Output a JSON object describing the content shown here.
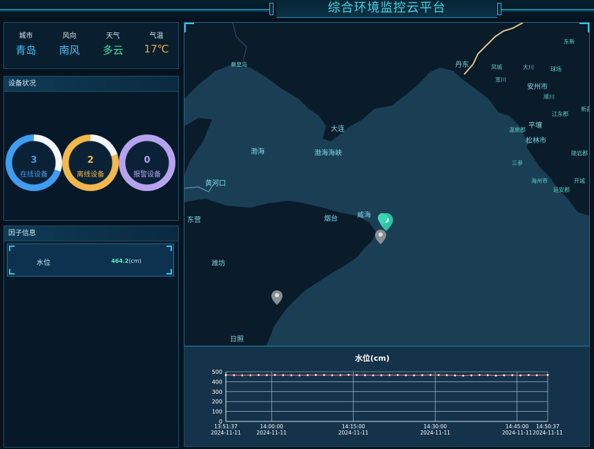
{
  "header": {
    "title": "综合环境监控云平台"
  },
  "weather": [
    {
      "label": "城市",
      "value": "青岛",
      "color": "#3fc6ff"
    },
    {
      "label": "风向",
      "value": "南风",
      "color": "#3fc6ff"
    },
    {
      "label": "天气",
      "value": "多云",
      "color": "#37e6a7"
    },
    {
      "label": "气温",
      "value": "17℃",
      "color": "#f2a93b"
    }
  ],
  "device_status": {
    "title": "设备状况",
    "rings": [
      {
        "count": "3",
        "label": "在线设备",
        "color": "#3f9df2",
        "fraction": 0.3
      },
      {
        "count": "2",
        "label": "离线设备",
        "color": "#f2b84b",
        "fraction": 0.2
      },
      {
        "count": "0",
        "label": "报警设备",
        "color": "#b6a3f0",
        "fraction": 0
      }
    ]
  },
  "factors": {
    "title": "因子信息",
    "items": [
      {
        "name": "水位",
        "value": "464.2",
        "unit": "(cm)"
      }
    ]
  },
  "map": {
    "labels": [
      {
        "text": "秦皇岛",
        "x": 333,
        "y": 93,
        "size": "sm"
      },
      {
        "text": "丹东",
        "x": 658,
        "y": 90,
        "size": "lg"
      },
      {
        "text": "东新",
        "x": 815,
        "y": 60,
        "size": "sm"
      },
      {
        "text": "凤城",
        "x": 710,
        "y": 97,
        "size": "sm"
      },
      {
        "text": "大川",
        "x": 756,
        "y": 97,
        "size": "sm"
      },
      {
        "text": "球场",
        "x": 796,
        "y": 100,
        "size": "sm"
      },
      {
        "text": "宣川",
        "x": 716,
        "y": 115,
        "size": "sm"
      },
      {
        "text": "安州市",
        "x": 762,
        "y": 122,
        "size": "lg"
      },
      {
        "text": "顺川",
        "x": 786,
        "y": 140,
        "size": "sm"
      },
      {
        "text": "江东郡",
        "x": 798,
        "y": 165,
        "size": "sm"
      },
      {
        "text": "新昌",
        "x": 840,
        "y": 158,
        "size": "sm"
      },
      {
        "text": "平壤",
        "x": 764,
        "y": 178,
        "size": "lg"
      },
      {
        "text": "温泉郡",
        "x": 736,
        "y": 188,
        "size": "sm"
      },
      {
        "text": "松林市",
        "x": 760,
        "y": 200,
        "size": "lg"
      },
      {
        "text": "大连",
        "x": 478,
        "y": 183,
        "size": "lg"
      },
      {
        "text": "渤海",
        "x": 362,
        "y": 216,
        "size": "lg"
      },
      {
        "text": "渤海海峡",
        "x": 454,
        "y": 218,
        "size": "lg"
      },
      {
        "text": "三参",
        "x": 740,
        "y": 236,
        "size": "sm"
      },
      {
        "text": "陵岩郡",
        "x": 826,
        "y": 222,
        "size": "sm"
      },
      {
        "text": "海州市",
        "x": 768,
        "y": 262,
        "size": "sm"
      },
      {
        "text": "开城",
        "x": 830,
        "y": 262,
        "size": "sm"
      },
      {
        "text": "延安郡",
        "x": 800,
        "y": 275,
        "size": "sm"
      },
      {
        "text": "黄河口",
        "x": 296,
        "y": 262,
        "size": "lg"
      },
      {
        "text": "威海",
        "x": 516,
        "y": 308,
        "size": "lg"
      },
      {
        "text": "烟台",
        "x": 468,
        "y": 313,
        "size": "lg"
      },
      {
        "text": "东营",
        "x": 270,
        "y": 315,
        "size": "lg"
      },
      {
        "text": "潍坊",
        "x": 305,
        "y": 378,
        "size": "lg"
      },
      {
        "text": "日照",
        "x": 332,
        "y": 488,
        "size": "lg"
      }
    ]
  },
  "chart_data": {
    "type": "line",
    "title": "水位(cm)",
    "ylabel": "",
    "ylim": [
      0,
      500
    ],
    "y_ticks": [
      "0",
      "100",
      "200",
      "300",
      "400",
      "500"
    ],
    "x_ticks": [
      {
        "time": "13:51:37",
        "date": "2024-11-11"
      },
      {
        "time": "14:00:00",
        "date": "2024-11-11"
      },
      {
        "time": "14:15:00",
        "date": "2024-11-11"
      },
      {
        "time": "14:30:00",
        "date": "2024-11-11"
      },
      {
        "time": "14:45:00",
        "date": "2024-11-11"
      },
      {
        "time": "14:50:37",
        "date": "2024-11-11"
      }
    ],
    "x_tick_minutes": [
      0,
      8.38,
      23.38,
      38.38,
      53.38,
      59
    ],
    "series": [
      {
        "color": "#e56a6a",
        "x_minutes": [
          0,
          1.5,
          3,
          4.5,
          6,
          7.5,
          9,
          10.5,
          12,
          13.5,
          15,
          16.5,
          18,
          19.5,
          21,
          22.5,
          24,
          25.5,
          27,
          28.5,
          30,
          31.5,
          33,
          34.5,
          36,
          37.5,
          39,
          40.5,
          42,
          43.5,
          45,
          46.5,
          48,
          49.5,
          51,
          52.5,
          54,
          55.5,
          57,
          59
        ],
        "values": [
          468,
          466,
          464,
          465,
          467,
          466,
          468,
          466,
          465,
          464,
          466,
          468,
          467,
          465,
          466,
          469,
          467,
          466,
          464,
          465,
          466,
          467,
          465,
          464,
          466,
          468,
          467,
          466,
          463,
          461,
          464,
          467,
          466,
          462,
          465,
          466,
          464,
          467,
          465,
          468
        ]
      }
    ]
  }
}
